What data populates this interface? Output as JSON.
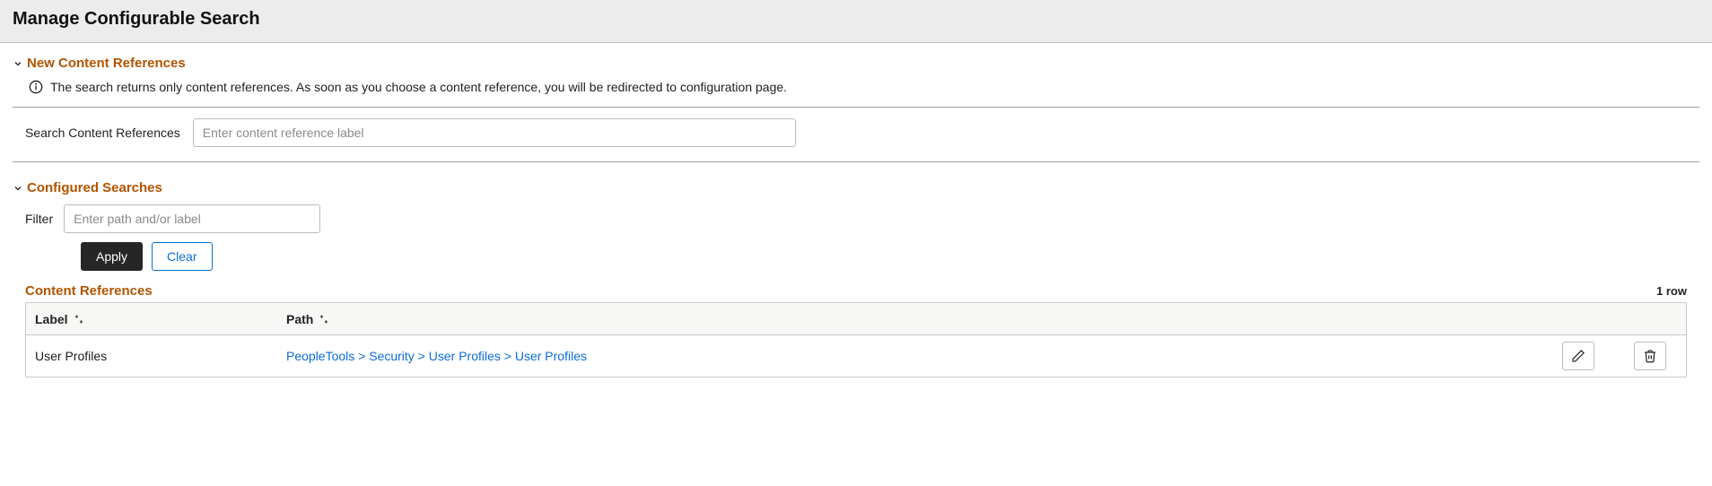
{
  "header": {
    "title": "Manage Configurable Search"
  },
  "new_content_refs": {
    "heading": "New Content References",
    "info_text": "The search returns only content references. As soon as you choose a content reference, you will be redirected to configuration page.",
    "search_label": "Search Content References",
    "search_placeholder": "Enter content reference label"
  },
  "configured_searches": {
    "heading": "Configured Searches",
    "filter_label": "Filter",
    "filter_placeholder": "Enter path and/or label",
    "apply_label": "Apply",
    "clear_label": "Clear",
    "table_title": "Content References",
    "row_count_label": "1 row",
    "columns": {
      "label": "Label",
      "path": "Path"
    },
    "rows": [
      {
        "label": "User Profiles",
        "path": "PeopleTools > Security > User Profiles > User Profiles"
      }
    ],
    "icons": {
      "edit": "pencil-icon",
      "delete": "trash-icon"
    }
  },
  "colors": {
    "accent": "#b25400",
    "link": "#0b6dd8",
    "primary_btn_bg": "#262626"
  }
}
